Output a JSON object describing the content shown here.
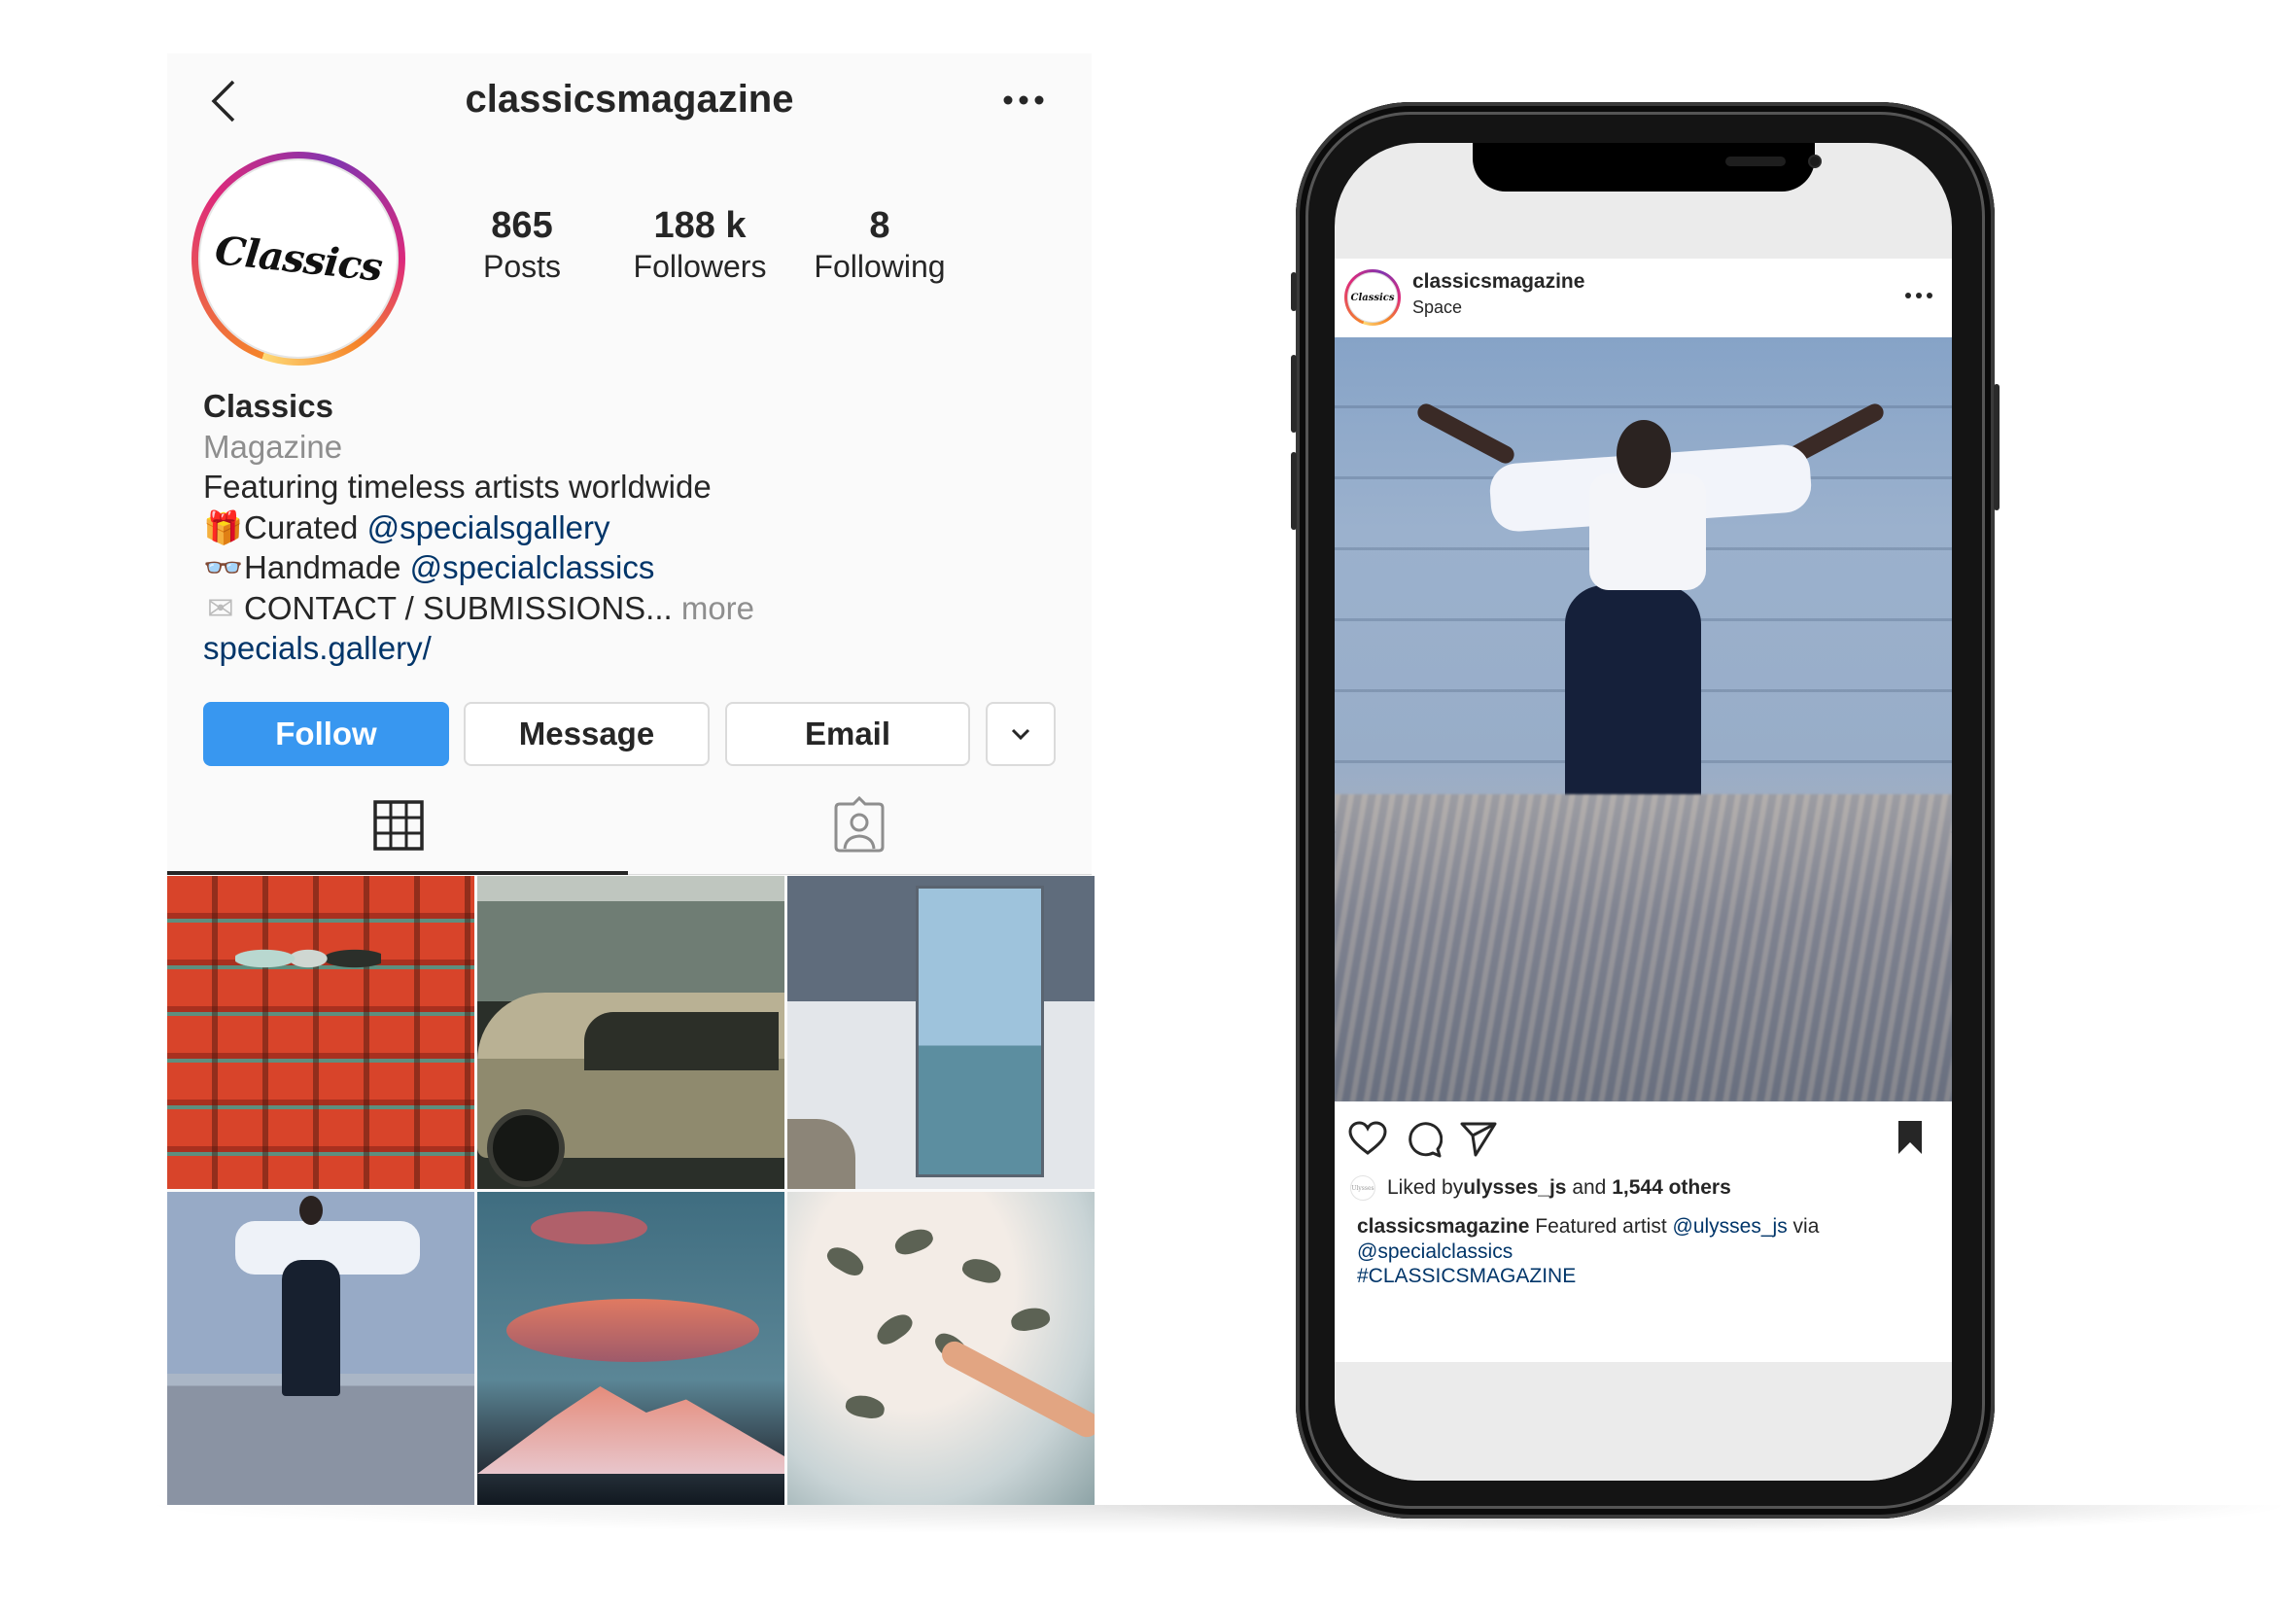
{
  "profile": {
    "username": "classicsmagazine",
    "avatar_logo_text": "Classics",
    "stats": [
      {
        "value": "865",
        "label": "Posts"
      },
      {
        "value": "188 k",
        "label": "Followers"
      },
      {
        "value": "8",
        "label": "Following"
      }
    ],
    "bio": {
      "name": "Classics",
      "category": "Magazine",
      "tagline": "Featuring timeless artists worldwide",
      "lines": [
        {
          "emoji": "🎁",
          "icon": "gift-icon",
          "text": "Curated ",
          "link": "@specialsgallery"
        },
        {
          "emoji": "👓",
          "icon": "glasses-icon",
          "text": "Handmade ",
          "link": "@specialclassics"
        },
        {
          "emoji": "✉",
          "icon": "envelope-icon",
          "text": "CONTACT / SUBMISSIONS...",
          "more": " more"
        }
      ],
      "website": "specials.gallery/"
    },
    "buttons": {
      "follow": "Follow",
      "message": "Message",
      "email": "Email"
    },
    "tabs": [
      {
        "icon": "grid-icon",
        "active": true
      },
      {
        "icon": "tagged-icon",
        "active": false
      }
    ],
    "grid_posts": [
      {
        "subject": "red theater seats"
      },
      {
        "subject": "vintage car"
      },
      {
        "subject": "door to sea"
      },
      {
        "subject": "woman against wall"
      },
      {
        "subject": "lenticular cloud over mountain"
      },
      {
        "subject": "birds and hand"
      }
    ]
  },
  "post": {
    "username": "classicsmagazine",
    "location": "Space",
    "avatar_logo_text": "Classics",
    "liked_by_prefix": "Liked by ",
    "liked_by_user": "ulysses_js",
    "liked_by_middle": " and ",
    "liked_by_count": "1,544 others",
    "liker_avatar_text": "Ulysses",
    "caption_user": "classicsmagazine",
    "caption_text": " Featured artist ",
    "caption_mention1": "@ulysses_js",
    "caption_via": " via",
    "caption_mention2": "@specialclassics",
    "caption_hashtag": "#CLASSICSMAGAZINE"
  },
  "colors": {
    "follow_blue": "#3897f0",
    "link_blue": "#003569",
    "muted_gray": "#8e8e8e",
    "text_dark": "#262626"
  }
}
